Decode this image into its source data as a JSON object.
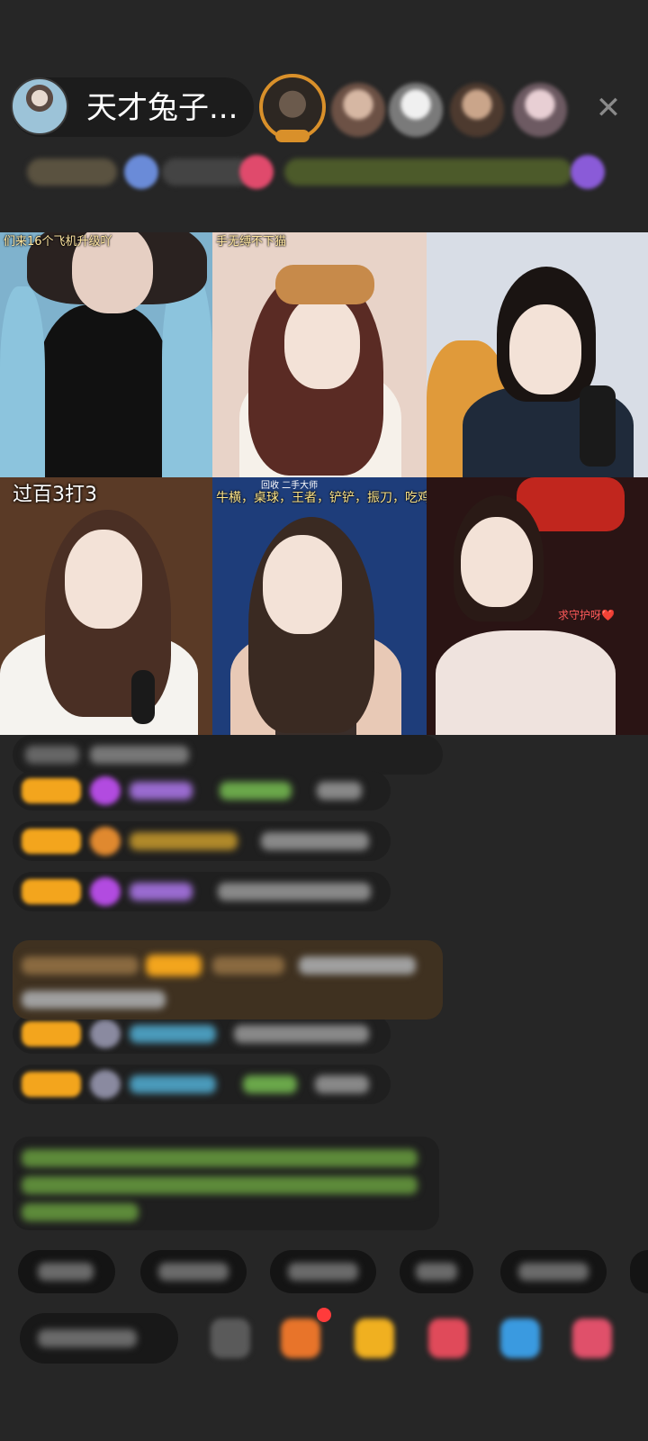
{
  "header": {
    "host_name": "天才兔子...",
    "close_label": "✕"
  },
  "grid": {
    "tiles": [
      {
        "caption": "们来16个飞机升级吖"
      },
      {
        "caption": "手无缚不下猫"
      },
      {
        "caption": ""
      },
      {
        "caption": "过百3打3"
      },
      {
        "caption": "牛横，桌球，王者，铲铲，振刀，吃鸡",
        "sub": "回收 二手大师"
      },
      {
        "caption": "",
        "overlay": "求守护呀❤️"
      }
    ]
  },
  "colors": {
    "background": "#262626",
    "gold_badge": "#f3a51d",
    "system_message": "#3f3120",
    "accent_pink": "#ff3b6b"
  }
}
